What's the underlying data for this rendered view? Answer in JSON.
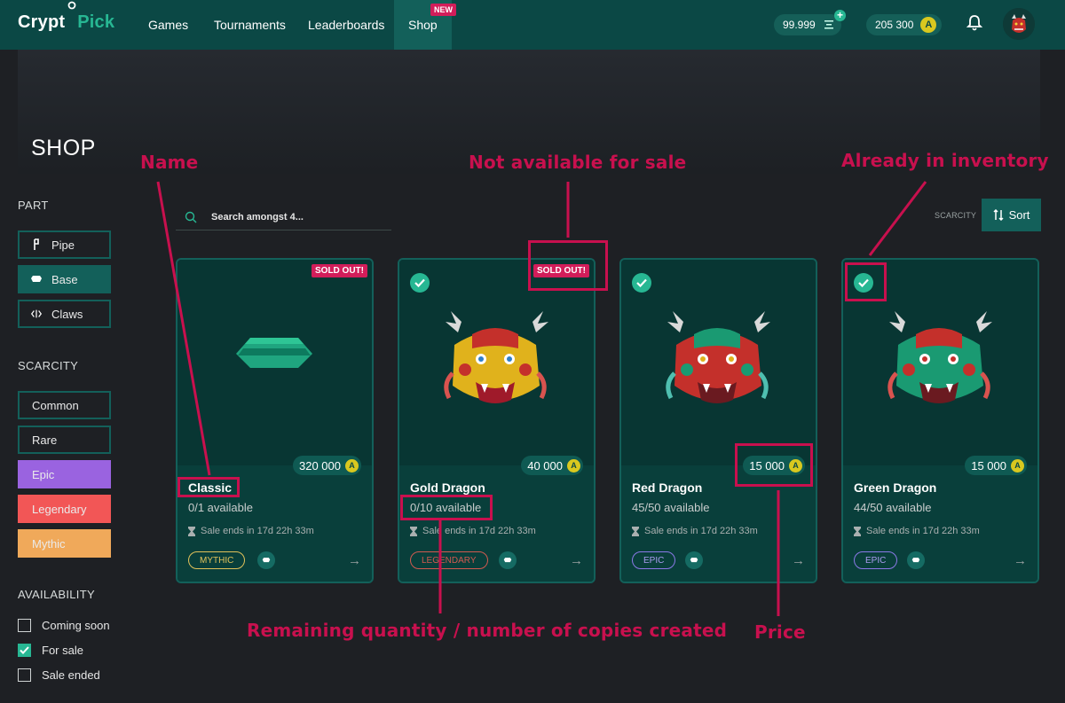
{
  "nav": {
    "logo_part1": "Crypt",
    "logo_part2": "Pick",
    "items": [
      {
        "label": "Games"
      },
      {
        "label": "Tournaments"
      },
      {
        "label": "Leaderboards"
      },
      {
        "label": "Shop",
        "badge": "NEW",
        "active": true
      }
    ],
    "balance_tokens": "99.999",
    "balance_coins": "205 300"
  },
  "page": {
    "title": "SHOP"
  },
  "sidebar": {
    "part_heading": "PART",
    "parts": [
      {
        "label": "Pipe",
        "icon": "pipe-icon"
      },
      {
        "label": "Base",
        "icon": "base-icon",
        "selected": true
      },
      {
        "label": "Claws",
        "icon": "claws-icon"
      }
    ],
    "scarcity_heading": "SCARCITY",
    "scarcities": [
      {
        "label": "Common",
        "color": ""
      },
      {
        "label": "Rare",
        "color": ""
      },
      {
        "label": "Epic",
        "color": "#9a63e0"
      },
      {
        "label": "Legendary",
        "color": "#f25656"
      },
      {
        "label": "Mythic",
        "color": "#f0a95a"
      }
    ],
    "availability_heading": "AVAILABILITY",
    "availability": [
      {
        "label": "Coming soon",
        "checked": false
      },
      {
        "label": "For sale",
        "checked": true
      },
      {
        "label": "Sale ended",
        "checked": false
      }
    ]
  },
  "toolbar": {
    "search_placeholder": "Search amongst 4...",
    "scarcity_label": "SCARCITY",
    "sort_label": "Sort"
  },
  "cards": [
    {
      "name": "Classic",
      "available": "0/1 available",
      "sale_ends": "Sale ends in 17d 22h 33m",
      "price": "320 000",
      "scarcity": "MYTHIC",
      "sold_out": "SOLD OUT!",
      "owned": false
    },
    {
      "name": "Gold Dragon",
      "available": "0/10 available",
      "sale_ends": "Sale ends in 17d 22h 33m",
      "price": "40 000",
      "scarcity": "LEGENDARY",
      "sold_out": "SOLD OUT!",
      "owned": true
    },
    {
      "name": "Red Dragon",
      "available": "45/50 available",
      "sale_ends": "Sale ends in 17d 22h 33m",
      "price": "15 000",
      "scarcity": "EPIC",
      "sold_out": "",
      "owned": true
    },
    {
      "name": "Green Dragon",
      "available": "44/50 available",
      "sale_ends": "Sale ends in 17d 22h 33m",
      "price": "15 000",
      "scarcity": "EPIC",
      "sold_out": "",
      "owned": true
    }
  ],
  "annotations": {
    "name": "Name",
    "not_available": "Not available for sale",
    "in_inventory": "Already in inventory",
    "remaining": "Remaining quantity / number of copies created",
    "price": "Price",
    "color": "#c8104e"
  }
}
